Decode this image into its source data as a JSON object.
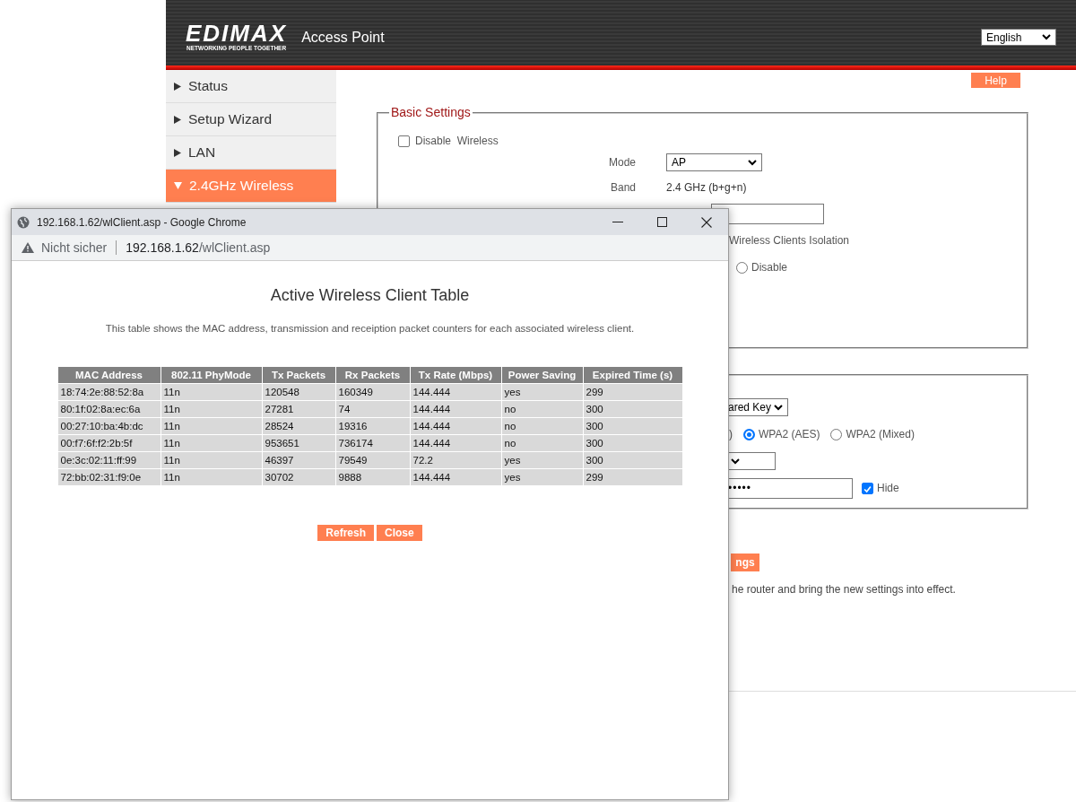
{
  "header": {
    "logo": "EDIMAX",
    "tagline": "NETWORKING PEOPLE TOGETHER",
    "title": "Access Point",
    "language": "English"
  },
  "sidebar": {
    "items": [
      {
        "label": "Status",
        "expanded": false,
        "selected": false
      },
      {
        "label": "Setup Wizard",
        "expanded": false,
        "selected": false
      },
      {
        "label": "LAN",
        "expanded": false,
        "selected": false
      },
      {
        "label": "2.4GHz Wireless",
        "expanded": true,
        "selected": true
      }
    ]
  },
  "help_button": "Help",
  "basic_settings": {
    "legend": "Basic Settings",
    "disable_wireless": {
      "label": "Disable  Wireless",
      "checked": false
    },
    "mode": {
      "label": "Mode",
      "value": "AP"
    },
    "band": {
      "label": "Band",
      "value": "2.4 GHz (b+g+n)"
    },
    "isolation_label": "Wireless Clients Isolation",
    "isolation_disable": {
      "label": "Disable",
      "selected": false
    }
  },
  "security": {
    "authentication_value": "ared Key",
    "encryption_fragment": ")",
    "encryption_options": [
      {
        "label": "WPA2 (AES)",
        "selected": true
      },
      {
        "label": "WPA2 (Mixed)",
        "selected": false
      }
    ],
    "key_value": "•••••",
    "hide": {
      "label": "Hide",
      "checked": true
    }
  },
  "apply_button": "ngs",
  "note": "he router and bring the new settings into effect.",
  "popup": {
    "title": "192.168.1.62/wlClient.asp - Google Chrome",
    "security_label": "Nicht sicher",
    "url": {
      "host": "192.168.1.62",
      "path": "/wlClient.asp"
    },
    "heading": "Active Wireless Client Table",
    "description": "This table shows the MAC address, transmission and receiption packet counters for each associated wireless client.",
    "table": {
      "columns": [
        "MAC Address",
        "802.11 PhyMode",
        "Tx Packets",
        "Rx Packets",
        "Tx Rate (Mbps)",
        "Power Saving",
        "Expired Time (s)"
      ],
      "rows": [
        [
          "18:74:2e:88:52:8a",
          "11n",
          "120548",
          "160349",
          "144.444",
          "yes",
          "299"
        ],
        [
          "80:1f:02:8a:ec:6a",
          "11n",
          "27281",
          "74",
          "144.444",
          "no",
          "300"
        ],
        [
          "00:27:10:ba:4b:dc",
          "11n",
          "28524",
          "19316",
          "144.444",
          "no",
          "300"
        ],
        [
          "00:f7:6f:f2:2b:5f",
          "11n",
          "953651",
          "736174",
          "144.444",
          "no",
          "300"
        ],
        [
          "0e:3c:02:11:ff:99",
          "11n",
          "46397",
          "79549",
          "72.2",
          "yes",
          "300"
        ],
        [
          "72:bb:02:31:f9:0e",
          "11n",
          "30702",
          "9888",
          "144.444",
          "yes",
          "299"
        ]
      ]
    },
    "buttons": [
      "Refresh",
      "Close"
    ]
  }
}
